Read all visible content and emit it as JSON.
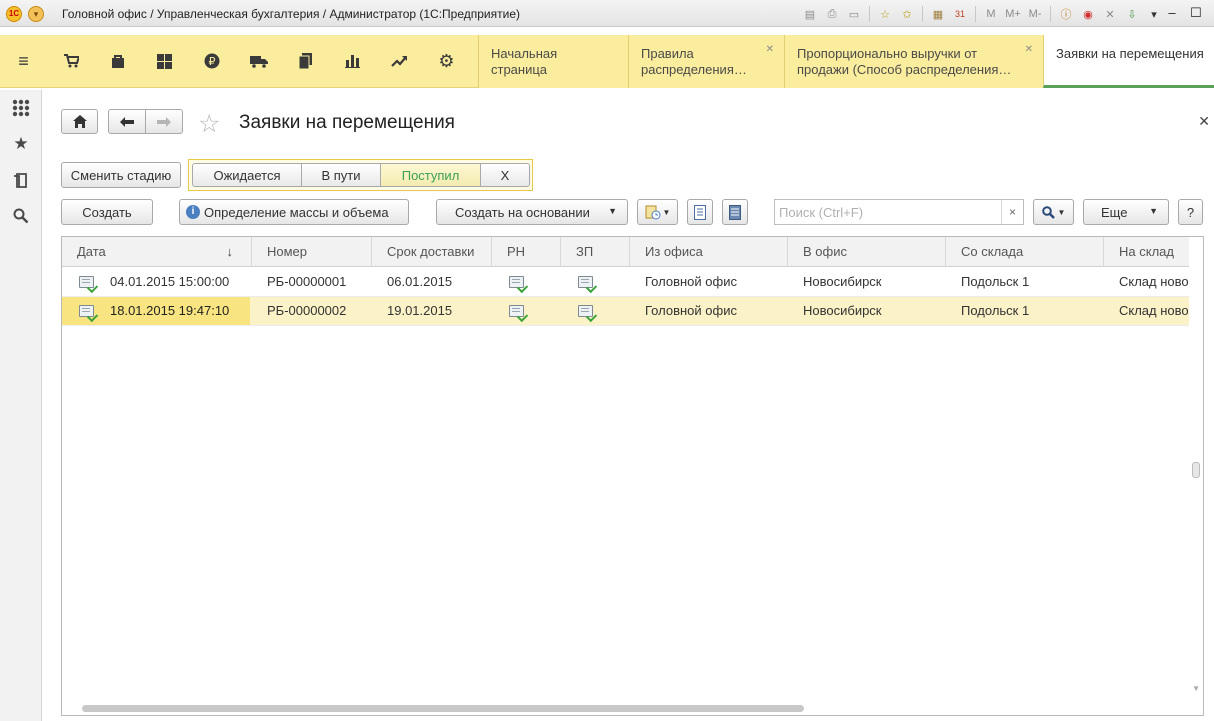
{
  "window": {
    "title": "Головной офис / Управленческая бухгалтерия / Администратор  (1С:Предприятие)",
    "toolbar_icons": [
      "save-icon",
      "print-icon",
      "print-preview-icon",
      "add-favorite-icon",
      "favorites-icon",
      "calculator-icon",
      "calendar-icon",
      "memory-m-icon",
      "memory-plus-icon",
      "memory-minus-icon",
      "info-icon",
      "record-icon",
      "stop-icon",
      "import-icon",
      "dropdown-icon"
    ],
    "memory_labels": {
      "m": "M",
      "mplus": "M+",
      "mminus": "M-"
    },
    "calendar_label": "31",
    "minimize_glyph": "‒",
    "maximize_glyph": "☐"
  },
  "sections": [
    "menu-icon",
    "cart-icon",
    "bag-icon",
    "warehouse-icon",
    "finance-icon",
    "truck-icon",
    "documents-icon",
    "chart-icon",
    "trend-icon",
    "settings-icon"
  ],
  "tabs": [
    {
      "label": "Начальная страница",
      "closable": false,
      "active": false
    },
    {
      "label": "Правила распределения…",
      "closable": true,
      "active": false
    },
    {
      "label": "Пропорционально выручки от продажи (Способ распределения…",
      "closable": true,
      "active": false
    },
    {
      "label": "Заявки на перемещения",
      "closable": false,
      "active": true
    }
  ],
  "left_panel": [
    "all-functions-icon",
    "favorites-star-icon",
    "history-icon",
    "search-icon"
  ],
  "form": {
    "title": "Заявки на перемещения",
    "change_stage_label": "Сменить стадию",
    "stages": [
      {
        "label": "Ожидается",
        "active": false
      },
      {
        "label": "В пути",
        "active": false
      },
      {
        "label": "Поступил",
        "active": true
      },
      {
        "label": "X",
        "active": false
      }
    ],
    "create_label": "Создать",
    "mass_volume_label": "Определение массы и объема",
    "create_based_label": "Создать на основании",
    "search_placeholder": "Поиск (Ctrl+F)",
    "search_clear": "×",
    "more_label": "Еще",
    "help_label": "?"
  },
  "table": {
    "columns": [
      "Дата",
      "Номер",
      "Срок доставки",
      "РН",
      "ЗП",
      "Из офиса",
      "В офис",
      "Со склада",
      "На склад"
    ],
    "sort_indicator": "↓",
    "rows": [
      {
        "date": "04.01.2015 15:00:00",
        "number": "РБ-00000001",
        "delivery": "06.01.2015",
        "from_office": "Головной офис",
        "to_office": "Новосибирск",
        "from_warehouse": "Подольск 1",
        "to_warehouse": "Склад ново",
        "selected": false
      },
      {
        "date": "18.01.2015 19:47:10",
        "number": "РБ-00000002",
        "delivery": "19.01.2015",
        "from_office": "Головной офис",
        "to_office": "Новосибирск",
        "from_warehouse": "Подольск 1",
        "to_warehouse": "Склад ново",
        "selected": true
      }
    ]
  }
}
